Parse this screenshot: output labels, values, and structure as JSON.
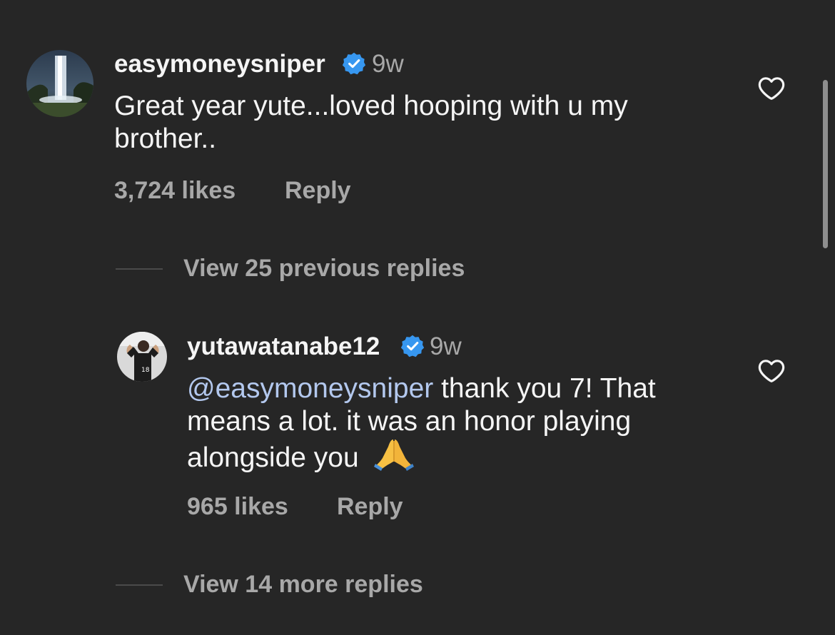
{
  "comments": [
    {
      "username": "easymoneysniper",
      "timestamp": "9w",
      "text": "Great year yute...loved hooping with u my brother..",
      "likes": "3,724 likes",
      "reply_label": "Reply",
      "verified": true
    },
    {
      "username": "yutawatanabe12",
      "timestamp": "9w",
      "mention": "@easymoneysniper",
      "text": "thank you 7! That means a lot. it was an honor playing alongside you",
      "emoji": "folded-hands",
      "likes": "965 likes",
      "reply_label": "Reply",
      "verified": true
    }
  ],
  "thread": {
    "previous_replies_label": "View 25 previous replies",
    "more_replies_label": "View 14 more replies"
  },
  "icons": {
    "verified": "verified-badge-icon",
    "like": "heart-outline-icon"
  },
  "colors": {
    "background": "#262626",
    "primary_text": "#f5f5f5",
    "secondary_text": "#a8a8a8",
    "verified_blue": "#3797f0",
    "mention": "#b3c8ee"
  }
}
